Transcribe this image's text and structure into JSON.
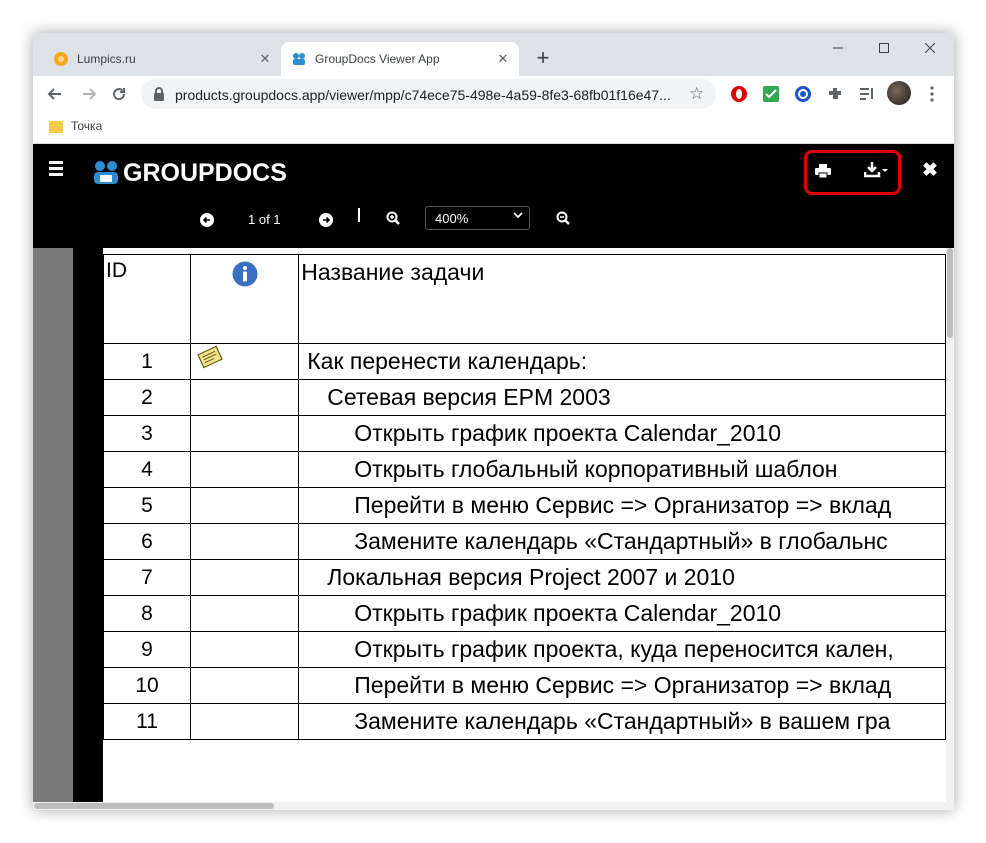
{
  "browser": {
    "tabs": [
      {
        "title": "Lumpics.ru",
        "active": false
      },
      {
        "title": "GroupDocs Viewer App",
        "active": true
      }
    ],
    "url": "products.groupdocs.app/viewer/mpp/c74ece75-498e-4a59-8fe3-68fb01f16e47...",
    "bookmarks": [
      {
        "label": "Точка"
      }
    ]
  },
  "viewer": {
    "logo_text": "GROUPDOCS",
    "page_info": "1 of 1",
    "zoom": "400%",
    "colors": {
      "highlight": "#e00000",
      "header_bg": "#000000",
      "logo_blue": "#2d8ecf"
    }
  },
  "document": {
    "headers": {
      "id": "ID",
      "name": "Название задачи"
    },
    "rows": [
      {
        "id": "1",
        "name": "Как перенести календарь:",
        "level": 1,
        "note": true
      },
      {
        "id": "2",
        "name": "Сетевая версия EPM 2003",
        "level": 2
      },
      {
        "id": "3",
        "name": "Открыть график проекта Calendar_2010",
        "level": 3
      },
      {
        "id": "4",
        "name": "Открыть глобальный корпоративный шаблон",
        "level": 3
      },
      {
        "id": "5",
        "name": "Перейти в меню Сервис => Организатор => вклад",
        "level": 3
      },
      {
        "id": "6",
        "name": "Замените календарь «Стандартный» в глобальнс",
        "level": 3
      },
      {
        "id": "7",
        "name": "Локальная версия Project 2007 и 2010",
        "level": 2
      },
      {
        "id": "8",
        "name": "Открыть график проекта Calendar_2010",
        "level": 3
      },
      {
        "id": "9",
        "name": "Открыть график проекта, куда переносится кален,",
        "level": 3
      },
      {
        "id": "10",
        "name": "Перейти в меню Сервис => Организатор => вклад",
        "level": 3
      },
      {
        "id": "11",
        "name": "Замените календарь «Стандартный» в вашем гра",
        "level": 3
      }
    ]
  }
}
